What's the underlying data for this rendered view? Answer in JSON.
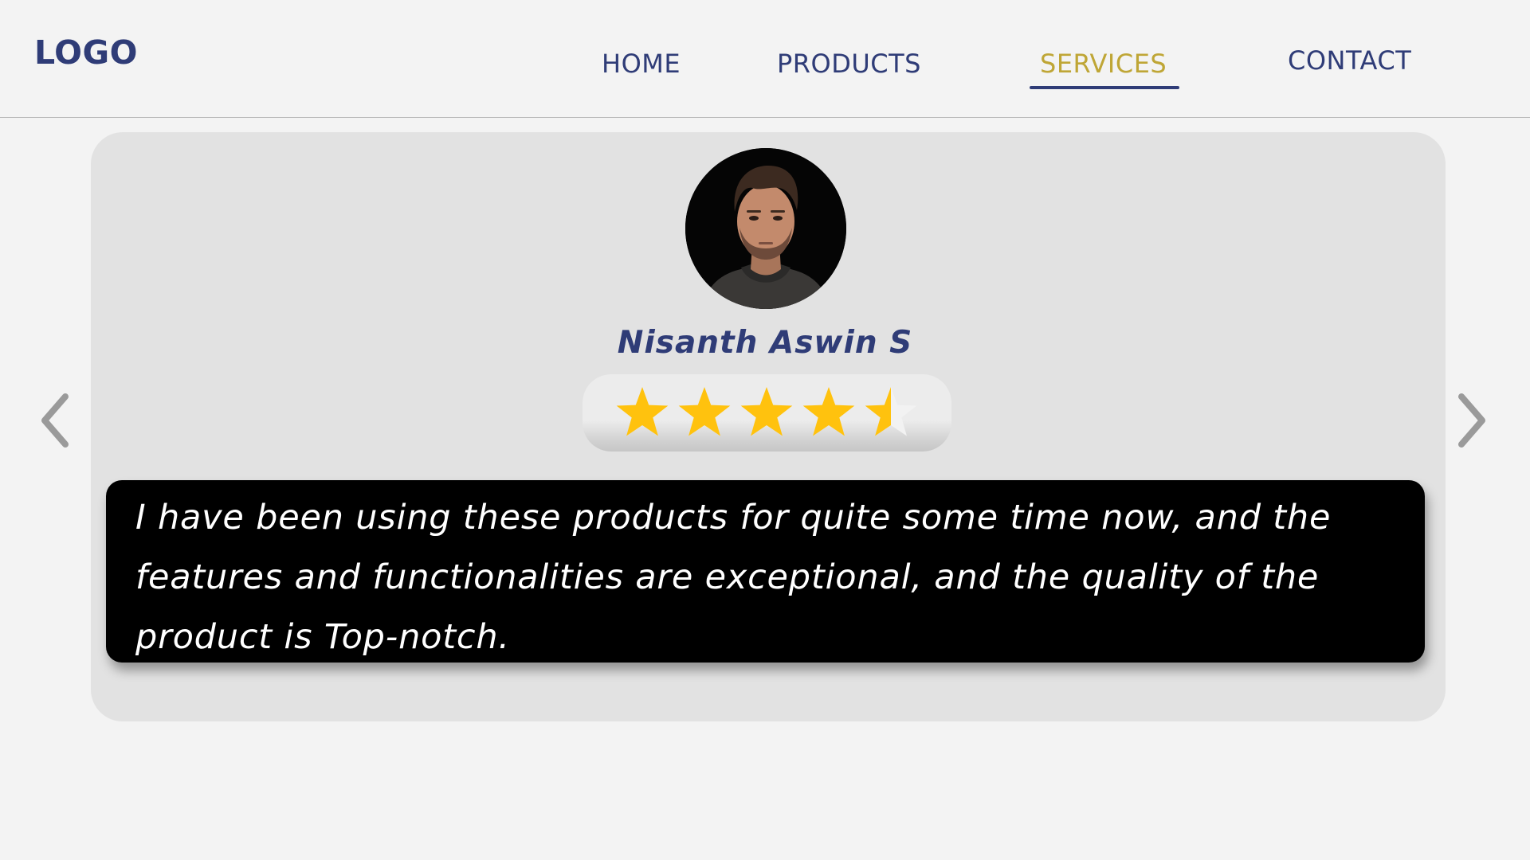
{
  "header": {
    "logo": "LOGO",
    "nav": [
      {
        "label": "HOME",
        "active": false
      },
      {
        "label": "PRODUCTS",
        "active": false
      },
      {
        "label": "SERVICES",
        "active": true
      },
      {
        "label": "CONTACT",
        "active": false
      }
    ]
  },
  "carousel": {
    "prev_icon": "chevron-left-icon",
    "next_icon": "chevron-right-icon"
  },
  "testimonial": {
    "name": "Nisanth Aswin S",
    "rating": 4.5,
    "rating_max": 5,
    "review": "I have been using these products for quite some time now, and the features and functionalities are exceptional, and the quality of the product is Top-notch."
  },
  "colors": {
    "brand": "#2f3c77",
    "active_nav": "#bfa636",
    "star": "#ffc20e",
    "star_empty": "#f2f2f2",
    "card_bg": "#e2e2e2",
    "review_bg": "#000000"
  }
}
